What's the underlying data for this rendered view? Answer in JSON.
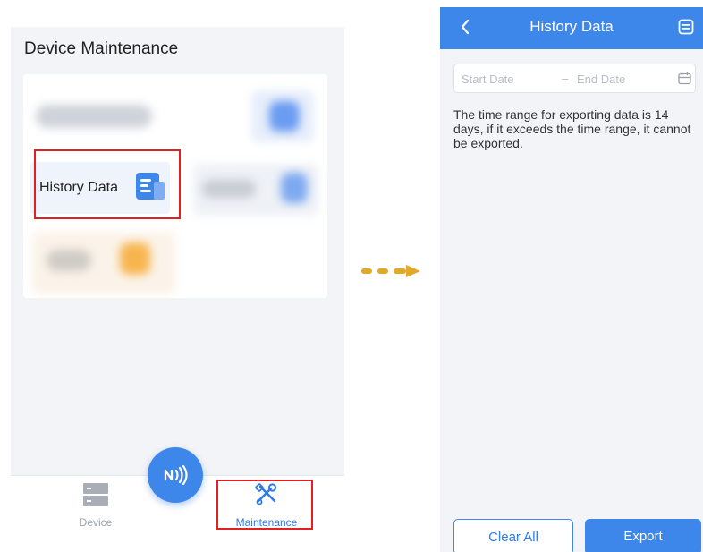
{
  "left_screen": {
    "title": "Device Maintenance",
    "history_tile_label": "History Data",
    "tabs": [
      {
        "label": "Device",
        "icon": "server-icon"
      },
      {
        "label": "Maintenance",
        "icon": "tools-icon",
        "active": true
      }
    ],
    "fab_icon": "nfc-icon"
  },
  "right_screen": {
    "header_title": "History Data",
    "date_start_placeholder": "Start Date",
    "date_separator": "–",
    "date_end_placeholder": "End Date",
    "note": "The time range for exporting data is 14 days, if it exceeds the time range, it cannot be exported.",
    "clear_label": "Clear All",
    "export_label": "Export"
  },
  "colors": {
    "accent": "#3d86ea",
    "highlight": "#e22020",
    "arrow": "#e0a92a"
  }
}
